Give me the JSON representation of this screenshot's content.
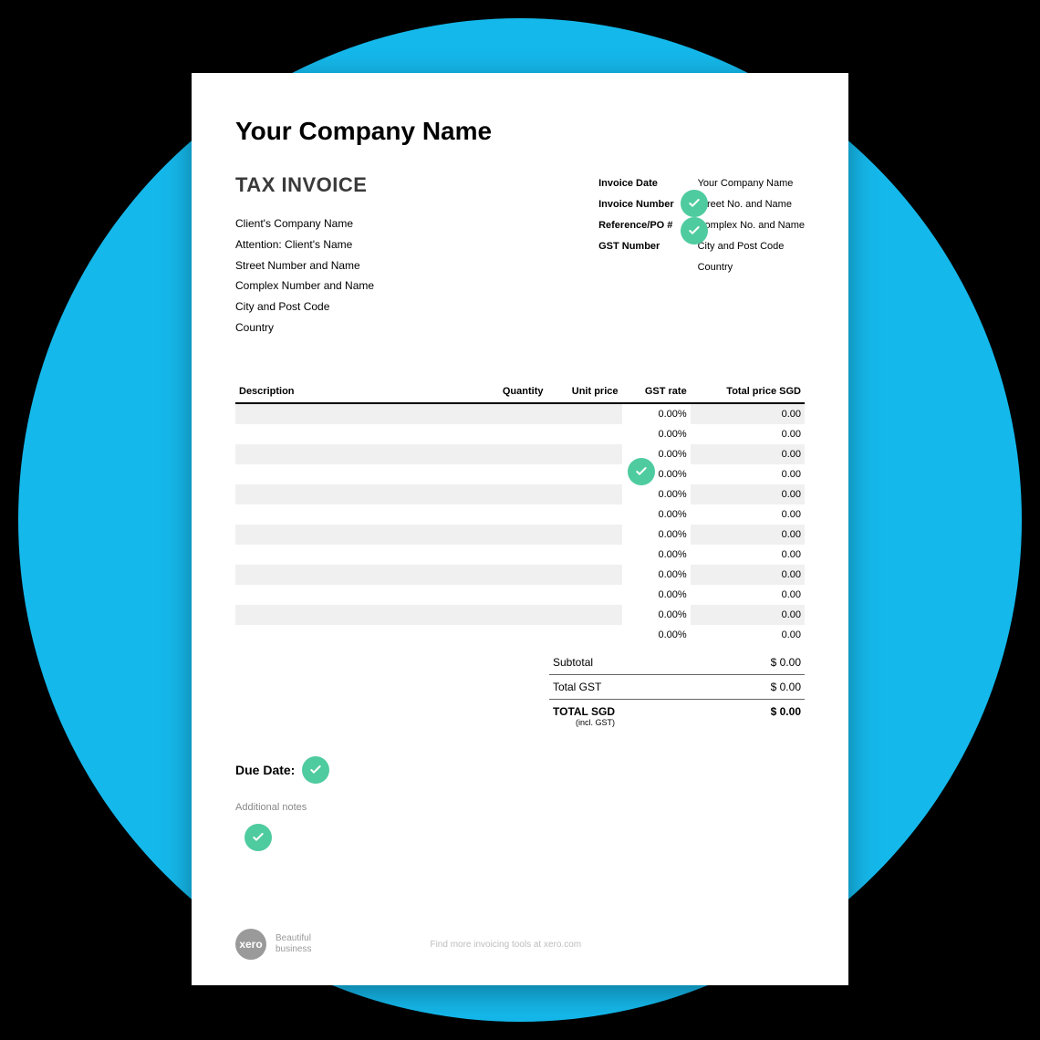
{
  "company_name": "Your Company Name",
  "doc_title": "TAX INVOICE",
  "client": {
    "company": "Client's Company Name",
    "attention": "Attention: Client's Name",
    "street": "Street Number and Name",
    "complex": "Complex Number and Name",
    "city": "City and Post Code",
    "country": "Country"
  },
  "meta_labels": {
    "invoice_date": "Invoice Date",
    "invoice_number": "Invoice Number",
    "reference": "Reference/PO #",
    "gst_number": "GST Number"
  },
  "sender": {
    "name": "Your Company Name",
    "street": "Street No. and Name",
    "complex": "Complex No. and Name",
    "city": "City and Post Code",
    "country": "Country"
  },
  "columns": {
    "description": "Description",
    "quantity": "Quantity",
    "unit_price": "Unit price",
    "gst_rate": "GST rate",
    "total_price": "Total price SGD"
  },
  "rows": [
    {
      "gst": "0.00%",
      "total": "0.00"
    },
    {
      "gst": "0.00%",
      "total": "0.00"
    },
    {
      "gst": "0.00%",
      "total": "0.00"
    },
    {
      "gst": "0.00%",
      "total": "0.00"
    },
    {
      "gst": "0.00%",
      "total": "0.00"
    },
    {
      "gst": "0.00%",
      "total": "0.00"
    },
    {
      "gst": "0.00%",
      "total": "0.00"
    },
    {
      "gst": "0.00%",
      "total": "0.00"
    },
    {
      "gst": "0.00%",
      "total": "0.00"
    },
    {
      "gst": "0.00%",
      "total": "0.00"
    },
    {
      "gst": "0.00%",
      "total": "0.00"
    },
    {
      "gst": "0.00%",
      "total": "0.00"
    }
  ],
  "totals": {
    "subtotal_label": "Subtotal",
    "subtotal_value": "$ 0.00",
    "gst_label": "Total GST",
    "gst_value": "$ 0.00",
    "total_label": "TOTAL SGD",
    "total_sub": "(incl. GST)",
    "total_value": "$ 0.00"
  },
  "due_date_label": "Due Date:",
  "notes_label": "Additional notes",
  "footer": {
    "brand": "xero",
    "tagline1": "Beautiful",
    "tagline2": "business",
    "link": "Find more invoicing tools at xero.com"
  }
}
